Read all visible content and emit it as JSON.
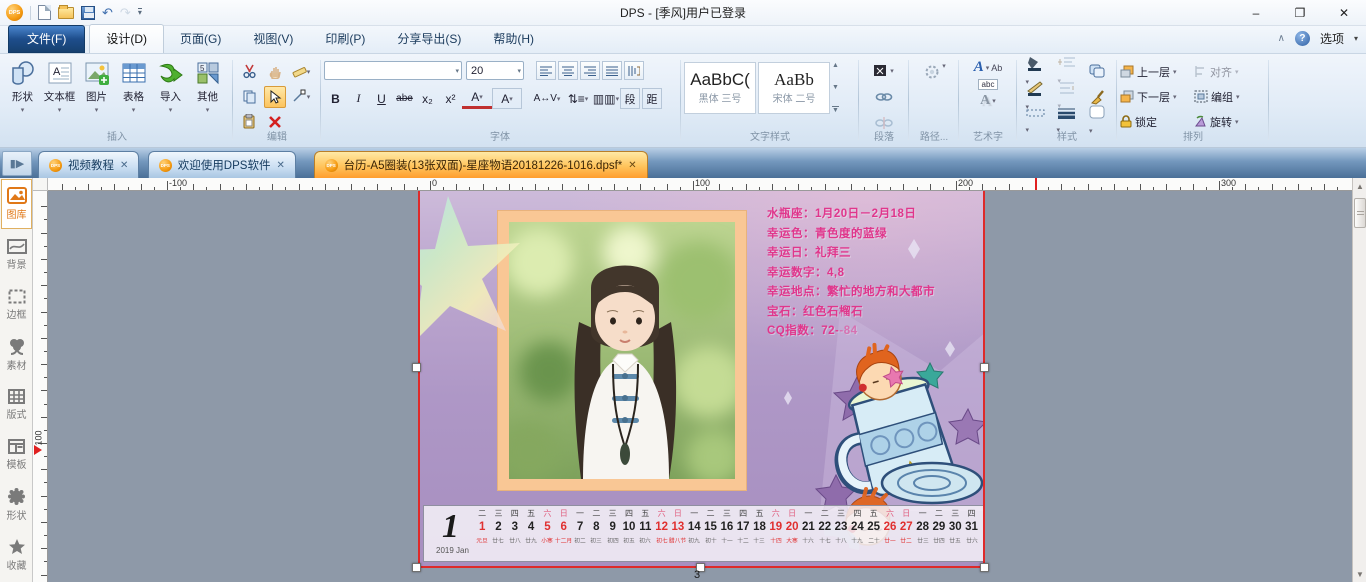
{
  "titlebar": {
    "app_title": "DPS - [季风]用户已登录",
    "minimize": "–",
    "maximize": "❐",
    "close": "✕"
  },
  "menus": [
    {
      "label": "文件(F)",
      "style": "file"
    },
    {
      "label": "设计(D)",
      "style": "active"
    },
    {
      "label": "页面(G)",
      "style": "plain"
    },
    {
      "label": "视图(V)",
      "style": "plain"
    },
    {
      "label": "印刷(P)",
      "style": "plain"
    },
    {
      "label": "分享导出(S)",
      "style": "plain"
    },
    {
      "label": "帮助(H)",
      "style": "plain"
    }
  ],
  "menurow_right": {
    "options_label": "选项"
  },
  "ribbon": {
    "insert": {
      "label": "插入",
      "buttons": [
        "形状",
        "文本框",
        "图片",
        "表格",
        "导入",
        "其他"
      ]
    },
    "edit": {
      "label": "编辑"
    },
    "font": {
      "label": "字体",
      "font_name_value": "",
      "font_size_value": "20",
      "char_buttons": [
        "B",
        "I",
        "U",
        "abe",
        "x₂",
        "x²"
      ],
      "color_button": "A",
      "size_button": "A",
      "spacing_button": "AV",
      "para_button": "段",
      "gap_button": "距"
    },
    "text_styles": {
      "label": "文字样式",
      "cards": [
        {
          "preview": "AaBbC(",
          "desc": "黑体 三号"
        },
        {
          "preview": "AaBb",
          "desc": "宋体 二号"
        }
      ]
    },
    "paragraph": {
      "label": "段落"
    },
    "path": {
      "label": "路径..."
    },
    "wordart": {
      "label": "艺术字",
      "abc_label": "abc",
      "a_label": "A",
      "case_label": "Ab"
    },
    "style": {
      "label": "样式"
    },
    "arrange": {
      "label": "排列",
      "buttons": [
        "上一层",
        "下一层",
        "锁定",
        "对齐",
        "编组",
        "旋转"
      ]
    }
  },
  "doc_tabs": [
    {
      "label": "视频教程",
      "active": false
    },
    {
      "label": "欢迎使用DPS软件",
      "active": false
    },
    {
      "label": "台历-A5圈装(13张双面)-星座物语20181226-1016.dpsf*",
      "active": true
    }
  ],
  "sidebar": [
    {
      "label": "图库",
      "icon": "gallery",
      "active": true
    },
    {
      "label": "背景",
      "icon": "background",
      "active": false
    },
    {
      "label": "边框",
      "icon": "border",
      "active": false
    },
    {
      "label": "素材",
      "icon": "material",
      "active": false
    },
    {
      "label": "版式",
      "icon": "layout",
      "active": false
    },
    {
      "label": "模板",
      "icon": "template",
      "active": false
    },
    {
      "label": "形状",
      "icon": "shape",
      "active": false
    },
    {
      "label": "收藏",
      "icon": "favorite",
      "active": false
    }
  ],
  "ruler": {
    "h_labels": [
      "-100",
      "0",
      "100",
      "200",
      "300"
    ],
    "v_label": "100"
  },
  "design": {
    "horoscope_lines": [
      "水瓶座：1月20日－2月18日",
      "幸运色：青色度的蓝绿",
      "幸运日：礼拜三",
      "幸运数字：4,8",
      "幸运地点：繁忙的地方和大都市",
      "宝石：红色石榴石",
      "CQ指数：72--84"
    ],
    "calendar": {
      "big_day": "1",
      "month_label": "2019 Jan",
      "days": [
        {
          "d": "1",
          "w": "二",
          "lunar": "元旦",
          "red": true,
          "lunar_red": true
        },
        {
          "d": "2",
          "w": "三",
          "lunar": "廿七",
          "red": false,
          "lunar_red": false
        },
        {
          "d": "3",
          "w": "四",
          "lunar": "廿八",
          "red": false,
          "lunar_red": false
        },
        {
          "d": "4",
          "w": "五",
          "lunar": "廿九",
          "red": false,
          "lunar_red": false
        },
        {
          "d": "5",
          "w": "六",
          "lunar": "小寒",
          "red": true,
          "lunar_red": true
        },
        {
          "d": "6",
          "w": "日",
          "lunar": "十二月",
          "red": true,
          "lunar_red": true
        },
        {
          "d": "7",
          "w": "一",
          "lunar": "初二",
          "red": false,
          "lunar_red": false
        },
        {
          "d": "8",
          "w": "二",
          "lunar": "初三",
          "red": false,
          "lunar_red": false
        },
        {
          "d": "9",
          "w": "三",
          "lunar": "初四",
          "red": false,
          "lunar_red": false
        },
        {
          "d": "10",
          "w": "四",
          "lunar": "初五",
          "red": false,
          "lunar_red": false
        },
        {
          "d": "11",
          "w": "五",
          "lunar": "初六",
          "red": false,
          "lunar_red": false
        },
        {
          "d": "12",
          "w": "六",
          "lunar": "初七",
          "red": true,
          "lunar_red": true
        },
        {
          "d": "13",
          "w": "日",
          "lunar": "腊八节",
          "red": true,
          "lunar_red": true
        },
        {
          "d": "14",
          "w": "一",
          "lunar": "初九",
          "red": false,
          "lunar_red": false
        },
        {
          "d": "15",
          "w": "二",
          "lunar": "初十",
          "red": false,
          "lunar_red": false
        },
        {
          "d": "16",
          "w": "三",
          "lunar": "十一",
          "red": false,
          "lunar_red": false
        },
        {
          "d": "17",
          "w": "四",
          "lunar": "十二",
          "red": false,
          "lunar_red": false
        },
        {
          "d": "18",
          "w": "五",
          "lunar": "十三",
          "red": false,
          "lunar_red": false
        },
        {
          "d": "19",
          "w": "六",
          "lunar": "十四",
          "red": true,
          "lunar_red": true
        },
        {
          "d": "20",
          "w": "日",
          "lunar": "大寒",
          "red": true,
          "lunar_red": true
        },
        {
          "d": "21",
          "w": "一",
          "lunar": "十六",
          "red": false,
          "lunar_red": false
        },
        {
          "d": "22",
          "w": "二",
          "lunar": "十七",
          "red": false,
          "lunar_red": false
        },
        {
          "d": "23",
          "w": "三",
          "lunar": "十八",
          "red": false,
          "lunar_red": false
        },
        {
          "d": "24",
          "w": "四",
          "lunar": "十九",
          "red": false,
          "lunar_red": false
        },
        {
          "d": "25",
          "w": "五",
          "lunar": "二十",
          "red": false,
          "lunar_red": false
        },
        {
          "d": "26",
          "w": "六",
          "lunar": "廿一",
          "red": true,
          "lunar_red": true
        },
        {
          "d": "27",
          "w": "日",
          "lunar": "廿二",
          "red": true,
          "lunar_red": true
        },
        {
          "d": "28",
          "w": "一",
          "lunar": "廿三",
          "red": false,
          "lunar_red": false
        },
        {
          "d": "29",
          "w": "二",
          "lunar": "廿四",
          "red": false,
          "lunar_red": false
        },
        {
          "d": "30",
          "w": "三",
          "lunar": "廿五",
          "red": false,
          "lunar_red": false
        },
        {
          "d": "31",
          "w": "四",
          "lunar": "廿六",
          "red": false,
          "lunar_red": false
        }
      ]
    },
    "page_number": "3",
    "colors": {
      "accent_orange": "#f59a10",
      "page_purple": "#ab94c4",
      "horoscope_pink": "#e0368c",
      "holiday_red": "#e03030",
      "frame_peach": "#f9c795"
    }
  }
}
